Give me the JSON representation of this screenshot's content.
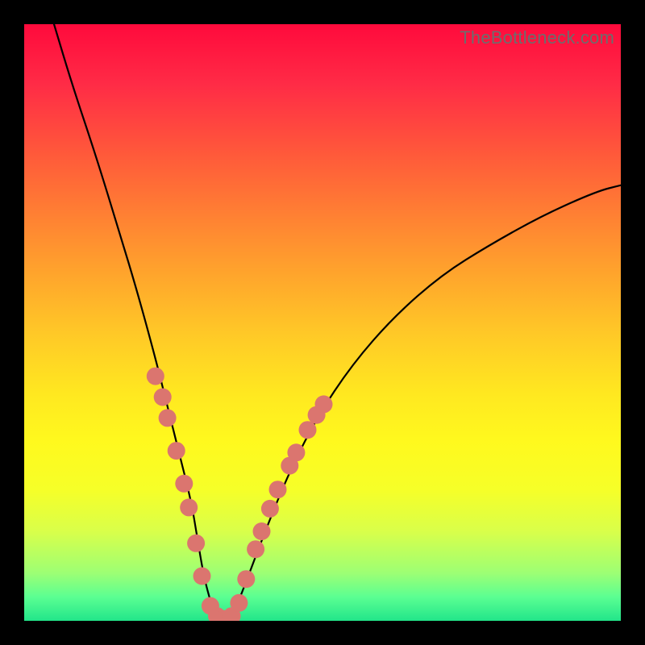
{
  "watermark": "TheBottleneck.com",
  "colors": {
    "marker": "#db756f",
    "curve": "#000000",
    "frame": "#000000"
  },
  "chart_data": {
    "type": "line",
    "title": "",
    "xlabel": "",
    "ylabel": "",
    "xlim": [
      0,
      100
    ],
    "ylim": [
      0,
      100
    ],
    "note": "Axes are unlabeled in the original image; x/y values are estimated from pixel positions on a 0–100 normalized scale. y=0 is bottom, y=100 is top.",
    "series": [
      {
        "name": "bottleneck-curve",
        "x": [
          5,
          8,
          12,
          16,
          19,
          22,
          24,
          26,
          28,
          29,
          30,
          31,
          32,
          33.5,
          35,
          37,
          40,
          44,
          49,
          55,
          62,
          70,
          78,
          87,
          96,
          100
        ],
        "y": [
          100,
          90,
          78,
          65,
          55,
          44,
          36,
          28,
          20,
          14,
          8,
          4,
          1,
          0,
          1,
          6,
          14,
          24,
          34,
          43,
          51,
          58,
          63,
          68,
          72,
          73
        ]
      }
    ],
    "markers": {
      "name": "highlighted-points",
      "points": [
        {
          "x": 22.0,
          "y": 41.0
        },
        {
          "x": 23.2,
          "y": 37.5
        },
        {
          "x": 24.0,
          "y": 34.0
        },
        {
          "x": 25.5,
          "y": 28.5
        },
        {
          "x": 26.8,
          "y": 23.0
        },
        {
          "x": 27.6,
          "y": 19.0
        },
        {
          "x": 28.8,
          "y": 13.0
        },
        {
          "x": 29.8,
          "y": 7.5
        },
        {
          "x": 31.2,
          "y": 2.5
        },
        {
          "x": 32.3,
          "y": 0.8
        },
        {
          "x": 33.5,
          "y": 0.3
        },
        {
          "x": 34.8,
          "y": 0.8
        },
        {
          "x": 36.0,
          "y": 3.0
        },
        {
          "x": 37.2,
          "y": 7.0
        },
        {
          "x": 38.8,
          "y": 12.0
        },
        {
          "x": 39.8,
          "y": 15.0
        },
        {
          "x": 41.2,
          "y": 18.8
        },
        {
          "x": 42.5,
          "y": 22.0
        },
        {
          "x": 44.5,
          "y": 26.0
        },
        {
          "x": 45.6,
          "y": 28.2
        },
        {
          "x": 47.5,
          "y": 32.0
        },
        {
          "x": 49.0,
          "y": 34.5
        },
        {
          "x": 50.2,
          "y": 36.3
        }
      ]
    }
  }
}
